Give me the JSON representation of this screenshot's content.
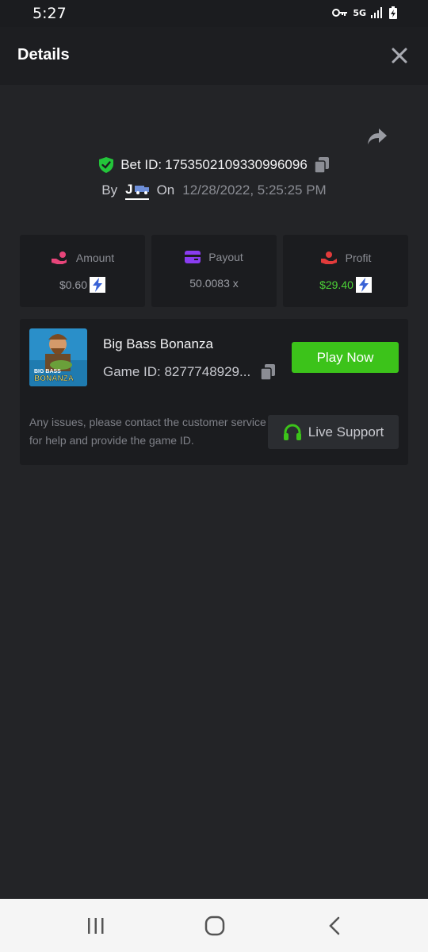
{
  "status_bar": {
    "time": "5:27",
    "network": "5G"
  },
  "header": {
    "title": "Details"
  },
  "bet": {
    "id_label": "Bet ID:",
    "id_value": "1753502109330996096",
    "by_label": "By",
    "user": "J",
    "on_label": "On",
    "date": "12/28/2022, 5:25:25 PM"
  },
  "stats": [
    {
      "label": "Amount",
      "value": "$0.60",
      "icon": "hand-coins-icon",
      "color": "#e8457a"
    },
    {
      "label": "Payout",
      "value": "50.0083 x",
      "icon": "wallet-icon",
      "color": "#8a3cf0"
    },
    {
      "label": "Profit",
      "value": "$29.40",
      "icon": "hand-money-icon",
      "color": "#e23b3b"
    }
  ],
  "game": {
    "name": "Big Bass Bonanza",
    "id_label": "Game ID: 8277748929...",
    "play_label": "Play Now",
    "thumb_text_1": "BIG BASS",
    "thumb_text_2": "BONANZA"
  },
  "support": {
    "message": "Any issues, please contact the customer service for help and provide the game ID.",
    "button_label": "Live Support"
  },
  "colors": {
    "accent_green": "#3cc31a",
    "profit_green": "#4cd137",
    "shield_green": "#23c43a"
  }
}
